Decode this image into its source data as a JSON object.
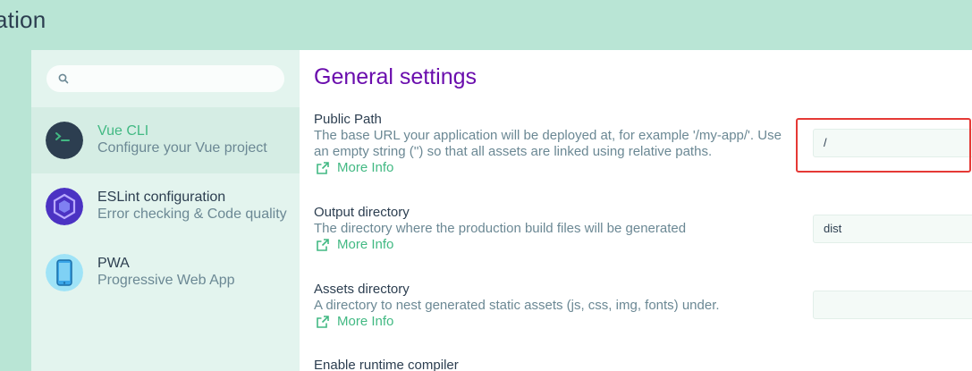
{
  "header": {
    "title": "ation"
  },
  "search": {
    "placeholder": ""
  },
  "sidebar": {
    "items": [
      {
        "title": "Vue CLI",
        "description": "Configure your Vue project",
        "icon": "vue-cli-icon"
      },
      {
        "title": "ESLint configuration",
        "description": "Error checking & Code quality",
        "icon": "eslint-icon"
      },
      {
        "title": "PWA",
        "description": "Progressive Web App",
        "icon": "pwa-phone-icon"
      }
    ]
  },
  "main": {
    "title": "General settings",
    "settings": [
      {
        "label": "Public Path",
        "description": "The base URL your application will be deployed at, for example '/my-app/'. Use an empty string ('') so that all assets are linked using relative paths.",
        "more": "More Info",
        "value": "/"
      },
      {
        "label": "Output directory",
        "description": "The directory where the production build files will be generated",
        "more": "More Info",
        "value": "dist"
      },
      {
        "label": "Assets directory",
        "description": "A directory to nest generated static assets (js, css, img, fonts) under.",
        "more": "More Info",
        "value": ""
      },
      {
        "label": "Enable runtime compiler"
      }
    ]
  },
  "colors": {
    "accent": "#42b983",
    "heading": "#6a0dad",
    "highlight": "#e53935"
  }
}
